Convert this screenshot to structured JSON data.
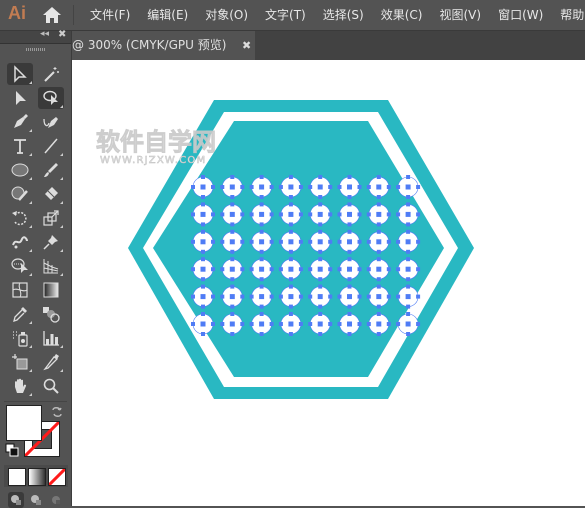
{
  "app": {
    "logo": "Ai",
    "logo_color": "#c27c52"
  },
  "menubar": {
    "items": [
      {
        "label": "文件(F)"
      },
      {
        "label": "编辑(E)"
      },
      {
        "label": "对象(O)"
      },
      {
        "label": "文字(T)"
      },
      {
        "label": "选择(S)"
      },
      {
        "label": "效果(C)"
      },
      {
        "label": "视图(V)"
      },
      {
        "label": "窗口(W)"
      },
      {
        "label": "帮助(H)"
      }
    ]
  },
  "document_tab": {
    "title": "@ 300% (CMYK/GPU 预览)",
    "close_glyph": "✖"
  },
  "tool_panel": {
    "collapse_glyph": "◂◂",
    "close_glyph": "✖",
    "tools": [
      {
        "name": "selection-tool",
        "active": true
      },
      {
        "name": "magic-wand-tool",
        "active": false
      },
      {
        "name": "direct-selection-tool",
        "active": false
      },
      {
        "name": "lasso-tool",
        "active": true
      },
      {
        "name": "pen-tool",
        "active": false
      },
      {
        "name": "curvature-tool",
        "active": false
      },
      {
        "name": "type-tool",
        "active": false
      },
      {
        "name": "line-segment-tool",
        "active": false
      },
      {
        "name": "ellipse-tool",
        "active": false
      },
      {
        "name": "paintbrush-tool",
        "active": false
      },
      {
        "name": "shaper-tool",
        "active": false
      },
      {
        "name": "eraser-tool",
        "active": false
      },
      {
        "name": "rotate-tool",
        "active": false
      },
      {
        "name": "scale-tool",
        "active": false
      },
      {
        "name": "puppet-warp-tool",
        "active": false
      },
      {
        "name": "pin-tool",
        "active": false
      },
      {
        "name": "shape-builder-tool",
        "active": false
      },
      {
        "name": "perspective-grid-tool",
        "active": false
      },
      {
        "name": "mesh-tool",
        "active": false
      },
      {
        "name": "gradient-tool",
        "active": false
      },
      {
        "name": "eyedropper-tool",
        "active": false
      },
      {
        "name": "blend-tool",
        "active": false
      },
      {
        "name": "symbol-sprayer-tool",
        "active": false
      },
      {
        "name": "column-graph-tool",
        "active": false
      },
      {
        "name": "artboard-tool",
        "active": false
      },
      {
        "name": "slice-tool",
        "active": false
      },
      {
        "name": "hand-tool",
        "active": false
      },
      {
        "name": "zoom-tool",
        "active": false
      }
    ],
    "fill_color": "#ffffff",
    "stroke_color": "none"
  },
  "artwork": {
    "hex_color": "#29b8c2",
    "gap_color": "#ffffff",
    "selection_color": "#4f7cf5",
    "grid_columns": 8,
    "grid_rows": 6,
    "circle_fill": "#ffffff"
  },
  "watermark": {
    "title": "软件自学网",
    "url": "WWW.RJZXW.COM"
  }
}
